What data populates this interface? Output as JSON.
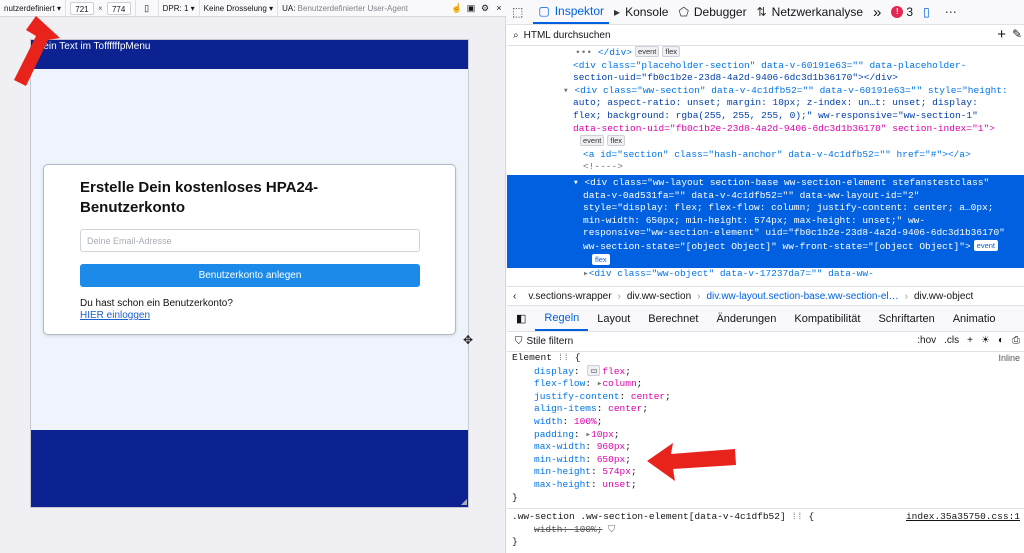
{
  "rdm": {
    "device": "nutzerdefiniert",
    "width": "721",
    "height": "774",
    "dpr": "DPR: 1",
    "throttle": "Keine Drosselung",
    "ua_label": "UA:",
    "ua_value": "Benutzerdefinierter User-Agent",
    "close": "×"
  },
  "page": {
    "top_text": "Mein Text im ToffffffpMenu",
    "title": "Erstelle Dein kostenloses HPA24-Benutzerkonto",
    "email_placeholder": "Deine Email-Adresse",
    "submit_label": "Benutzerkonto anlegen",
    "login_question": "Du hast schon ein Benutzerkonto?",
    "login_link": "HIER einloggen"
  },
  "devtools": {
    "tabs": [
      "Inspektor",
      "Konsole",
      "Debugger",
      "Netzwerkanalyse"
    ],
    "more": "»",
    "error_count": "3",
    "search_placeholder": "HTML durchsuchen",
    "breadcrumbs": [
      "v.sections-wrapper",
      "div.ww-section",
      "div.ww-layout.section-base.ww-section-el…",
      "div.ww-object"
    ],
    "rules_tabs": [
      "Regeln",
      "Layout",
      "Berechnet",
      "Änderungen",
      "Kompatibilität",
      "Schriftarten",
      "Animatio"
    ],
    "filter_placeholder": "Stile filtern",
    "hov": ":hov",
    "cls": ".cls",
    "inline_label": "Inline"
  },
  "markup_lines": {
    "l1": "</div>",
    "l2a": "<div class=\"placeholder-section\" data-v-60191e63=\"\" data-placeholder-",
    "l2b": "section-uid=\"fb0c1b2e-23d8-4a2d-9406-6dc3d1b36170\"></div>",
    "l3a": "<div class=\"ww-section\" data-v-4c1dfb52=\"\" data-v-60191e63=\"\" style=\"height:",
    "l3b": "auto; aspect-ratio: unset; margin: 10px; z-index: un…t: unset; display:",
    "l3c": "flex; background: rgba(255, 255, 255, 0);\" ww-responsive=\"ww-section-1\"",
    "l3d": "data-section-uid=\"fb0c1b2e-23d8-4a2d-9406-6dc3d1b36170\" section-index=\"1\">",
    "l4": "<a id=\"section\" class=\"hash-anchor\" data-v-4c1dfb52=\"\" href=\"#\"></a>",
    "l5": "<!---->",
    "s1": "<div class=\"ww-layout section-base ww-section-element stefanstestclass\"",
    "s2": "data-v-0ad531fa=\"\" data-v-4c1dfb52=\"\" data-ww-layout-id=\"2\"",
    "s3": "style=\"display: flex; flex-flow: column; justify-content: center; a…0px;",
    "s4": "min-width: 650px; min-height: 574px; max-height: unset;\" ww-",
    "s5": "responsive=\"ww-section-element\" uid=\"fb0c1b2e-23d8-4a2d-9406-6dc3d1b36170\"",
    "s6": "ww-section-state=\"[object Object]\" ww-front-state=\"[object Object]\">",
    "l6": "<div class=\"ww-object\" data-v-17237da7=\"\" data-ww-"
  },
  "badges": {
    "event": "event",
    "flex": "flex"
  },
  "rules": {
    "element_selector": "Element",
    "decls": [
      {
        "p": "display",
        "v": "flex"
      },
      {
        "p": "flex-flow",
        "v": "column"
      },
      {
        "p": "justify-content",
        "v": "center"
      },
      {
        "p": "align-items",
        "v": "center"
      },
      {
        "p": "width",
        "v": "100%"
      },
      {
        "p": "padding",
        "v": "10px"
      },
      {
        "p": "max-width",
        "v": "960px"
      },
      {
        "p": "min-width",
        "v": "650px"
      },
      {
        "p": "min-height",
        "v": "574px"
      },
      {
        "p": "max-height",
        "v": "unset"
      }
    ],
    "rule2_selector": ".ww-section .ww-section-element[data-v-4c1dfb52]",
    "rule2_source": "index.35a35750.css:1",
    "rule2_decl_p": "width",
    "rule2_decl_v": "100%"
  },
  "colors": {
    "brand_blue": "#0c2291",
    "button_blue": "#1b8ae8",
    "accent": "#0061e0",
    "arrow_red": "#e8231b"
  }
}
